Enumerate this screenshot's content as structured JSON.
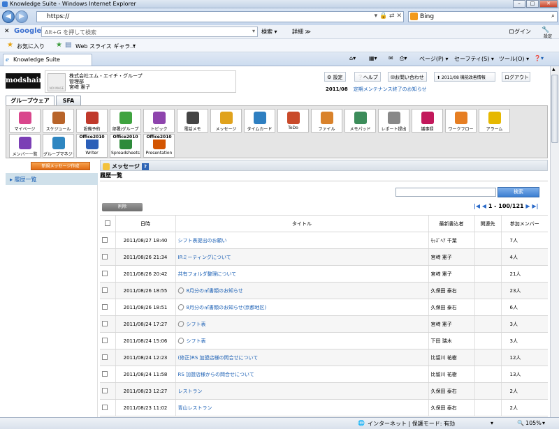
{
  "window": {
    "title": "Knowledge Suite - Windows Internet Explorer"
  },
  "address": {
    "url": "https://",
    "search_engine": "Bing"
  },
  "google_bar": {
    "placeholder": "Alt+G を押して検索",
    "search_label": "検索 ▾",
    "more_label": "詳細 ≫",
    "login_label": "ログイン",
    "settings_label": "設定"
  },
  "favorites": {
    "favorites_label": "お気に入り",
    "webslice_label": "Web スライス ギャラ..."
  },
  "tab": {
    "label": "Knowledge Suite"
  },
  "commands": {
    "page": "ページ(P) ▾",
    "safety": "セーフティ(S) ▾",
    "tools": "ツール(O) ▾"
  },
  "header": {
    "logo": "modshair",
    "company": "株式会社エム・エイチ・グループ",
    "dept": "管理部",
    "user": "宮﨑 憲子",
    "avatar_text": "NO IMAGE",
    "buttons": [
      "設定",
      "ヘルプ",
      "お問い合わせ",
      "2011/08 機能改善情報",
      "ログアウト"
    ],
    "notice_date": "2011/08",
    "notice_text": "定期メンテナンス終了のお知らせ"
  },
  "main_tabs": [
    "グループウェア",
    "SFA"
  ],
  "menu_items": [
    {
      "label": "マイページ",
      "color": "#d9468c"
    },
    {
      "label": "スケジュール",
      "color": "#b8642a"
    },
    {
      "label": "設備予約",
      "color": "#c0392b"
    },
    {
      "label": "部署/グループ",
      "color": "#3fa33f"
    },
    {
      "label": "トピック",
      "color": "#8e44ad"
    },
    {
      "label": "電話メモ",
      "color": "#444444"
    },
    {
      "label": "メッセージ",
      "color": "#e0a21c"
    },
    {
      "label": "タイムカード",
      "color": "#2e7fc1"
    },
    {
      "label": "ToDo",
      "color": "#c94a2a"
    },
    {
      "label": "ファイル",
      "color": "#d9822b"
    },
    {
      "label": "メモパッド",
      "color": "#3c8c5a"
    },
    {
      "label": "レポート提出",
      "color": "#888888"
    },
    {
      "label": "議事録",
      "color": "#c2185b"
    },
    {
      "label": "ワークフロー",
      "color": "#e67e22"
    },
    {
      "label": "アラーム",
      "color": "#e6b800"
    },
    {
      "label": "メンバー一覧",
      "color": "#7b3fb5"
    },
    {
      "label": "グループマネジャー",
      "color": "#2e86c1"
    },
    {
      "label": "Writer",
      "top": "Office2010",
      "color": "#2b5fb8"
    },
    {
      "label": "Spreadsheets",
      "top": "Office2010",
      "color": "#2e8b3a"
    },
    {
      "label": "Presentation",
      "top": "Office2010",
      "color": "#d35400"
    }
  ],
  "sidebar": {
    "new_button": "新規メッセージ作成",
    "items": [
      "履歴一覧"
    ]
  },
  "section": {
    "title": "メッセージ",
    "subtitle": "履歴一覧"
  },
  "search": {
    "button": "検索",
    "value": ""
  },
  "pager": {
    "text": "1 - 100/121"
  },
  "delete_button": "削除",
  "table": {
    "headers": [
      "日時",
      "タイトル",
      "最新書込者",
      "関連先",
      "参加メンバー"
    ],
    "rows": [
      {
        "date": "2011/08/27 18:40",
        "title": "シフト表提出のお願い",
        "attach": false,
        "writer": "ﾓｯｽﾞﾍｱ 千葉",
        "related": "",
        "members": "7人"
      },
      {
        "date": "2011/08/26 21:34",
        "title": "IRミーティングについて",
        "attach": false,
        "writer": "宮﨑 憲子",
        "related": "",
        "members": "4人"
      },
      {
        "date": "2011/08/26 20:42",
        "title": "共有フォルダ整理について",
        "attach": false,
        "writer": "宮﨑 憲子",
        "related": "",
        "members": "21人"
      },
      {
        "date": "2011/08/26 18:55",
        "title": "8月分の㎡書類のお知らせ",
        "attach": true,
        "writer": "久保田 泰右",
        "related": "",
        "members": "23人"
      },
      {
        "date": "2011/08/26 18:51",
        "title": "8月分の㎡書類のお知らせ(京都地区)",
        "attach": true,
        "writer": "久保田 泰右",
        "related": "",
        "members": "6人"
      },
      {
        "date": "2011/08/24 17:27",
        "title": "シフト表",
        "attach": true,
        "writer": "宮﨑 憲子",
        "related": "",
        "members": "3人"
      },
      {
        "date": "2011/08/24 15:06",
        "title": "シフト表",
        "attach": true,
        "writer": "下田 瑞木",
        "related": "",
        "members": "3人"
      },
      {
        "date": "2011/08/24 12:23",
        "title": "(修正)RS 加盟店様の問合せについて",
        "attach": false,
        "writer": "比留川 祐樹",
        "related": "",
        "members": "12人"
      },
      {
        "date": "2011/08/24 11:58",
        "title": "RS 加盟店様からの問合せについて",
        "attach": false,
        "writer": "比留川 祐樹",
        "related": "",
        "members": "13人"
      },
      {
        "date": "2011/08/23 12:27",
        "title": "レストラン",
        "attach": false,
        "writer": "久保田 泰右",
        "related": "",
        "members": "2人"
      },
      {
        "date": "2011/08/23 11:02",
        "title": "青山レストラン",
        "attach": false,
        "writer": "久保田 泰右",
        "related": "",
        "members": "2人"
      }
    ]
  },
  "status": {
    "zone": "インターネット | 保護モード: 有効",
    "zoom": "105%"
  }
}
